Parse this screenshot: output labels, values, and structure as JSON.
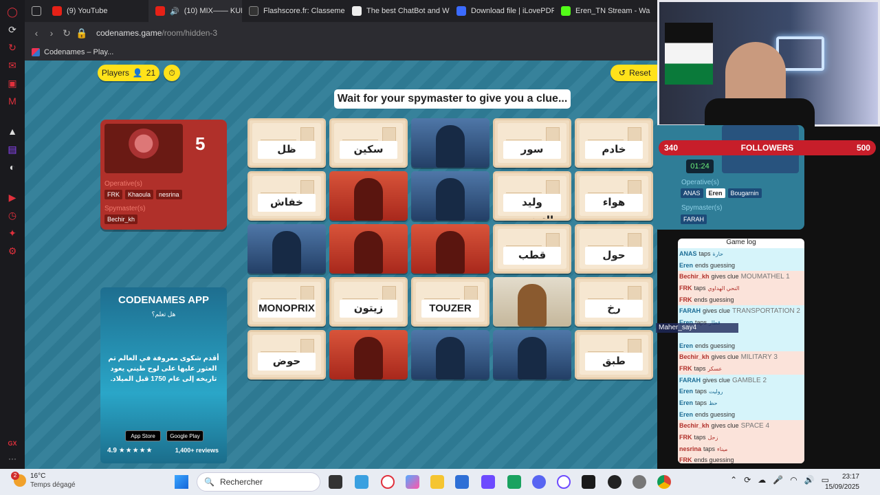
{
  "browser": {
    "tabs": [
      {
        "label": "(9) YouTube",
        "color": "#e62117"
      },
      {
        "label": "(10) MIX—— KUN A",
        "color": "#e62117"
      },
      {
        "label": "Flashscore.fr: Classeme",
        "color": "#333"
      },
      {
        "label": "The best ChatBot and W",
        "color": "#eee"
      },
      {
        "label": "Download file | iLovePDF",
        "color": "#3b6bff"
      },
      {
        "label": "Eren_TN Stream - Wa",
        "color": "#53fc18"
      }
    ],
    "url_host": "codenames.game",
    "url_path": "/room/hidden-3",
    "bookmark": "Codenames – Play..."
  },
  "game": {
    "players_label": "Players",
    "players_count": "21",
    "reset_label": "Reset",
    "banner": "Wait for your spymaster to give you a clue...",
    "red_team": {
      "score": "5",
      "operatives_label": "Operative(s)",
      "operatives": [
        "FRK",
        "Khaoula",
        "nesrina"
      ],
      "spymaster_label": "Spymaster(s)",
      "spymaster": "Bechir_kh"
    },
    "blue_team": {
      "timer": "01:24",
      "operatives_label": "Operative(s)",
      "operatives": [
        "ANAS",
        "Eren",
        "Bougarnin"
      ],
      "spymaster_label": "Spymaster(s)",
      "spymaster": "FARAH"
    },
    "cards": [
      {
        "type": "word",
        "text": "ظل"
      },
      {
        "type": "word",
        "text": "سكين"
      },
      {
        "type": "blue",
        "text": ""
      },
      {
        "type": "word",
        "text": "سور"
      },
      {
        "type": "word",
        "text": "خادم"
      },
      {
        "type": "word",
        "text": "خفاش"
      },
      {
        "type": "red",
        "text": ""
      },
      {
        "type": "blue",
        "text": ""
      },
      {
        "type": "word",
        "text": "وليد التونسي"
      },
      {
        "type": "word",
        "text": "هواء"
      },
      {
        "type": "blue",
        "text": ""
      },
      {
        "type": "red",
        "text": ""
      },
      {
        "type": "red",
        "text": ""
      },
      {
        "type": "word",
        "text": "قطب"
      },
      {
        "type": "word",
        "text": "حول"
      },
      {
        "type": "word",
        "text": "MONOPRIX"
      },
      {
        "type": "word",
        "text": "زيتون"
      },
      {
        "type": "word",
        "text": "TOUZER"
      },
      {
        "type": "neutral",
        "text": ""
      },
      {
        "type": "word",
        "text": "رخ"
      },
      {
        "type": "word",
        "text": "حوض"
      },
      {
        "type": "red",
        "text": ""
      },
      {
        "type": "blue",
        "text": ""
      },
      {
        "type": "blue",
        "text": ""
      },
      {
        "type": "word",
        "text": "طبق"
      }
    ]
  },
  "app_ad": {
    "title": "CODENAMES APP",
    "subtitle": "هل تعلم؟",
    "fact": "أقدم شكوى معروفة في العالم تم العثور عليها على لوح طيني يعود تاريخه إلى عام 1750 قبل الميلاد.",
    "app_store": "App Store",
    "google_play": "Google Play",
    "rating": "4.9",
    "reviews": "1,400+ reviews"
  },
  "stream": {
    "followers_current": "340",
    "followers_label": "FOLLOWERS",
    "followers_goal": "500",
    "chat_user": "Maher_say4"
  },
  "game_log": {
    "title": "Game log",
    "rows": [
      {
        "team": "blue",
        "player": "ANAS",
        "action": "taps",
        "extra": "حارة"
      },
      {
        "team": "blue",
        "player": "Eren",
        "action": "ends guessing",
        "extra": ""
      },
      {
        "team": "red",
        "player": "Bechir_kh",
        "action": "gives clue",
        "extra": "MOUMATHEL 1"
      },
      {
        "team": "red",
        "player": "FRK",
        "action": "taps",
        "extra": "النحي الهداوي"
      },
      {
        "team": "red",
        "player": "FRK",
        "action": "ends guessing",
        "extra": ""
      },
      {
        "team": "blue",
        "player": "FARAH",
        "action": "gives clue",
        "extra": "TRANSPORTATION 2"
      },
      {
        "team": "blue",
        "player": "Eren",
        "action": "taps",
        "extra": "قطار"
      },
      {
        "team": "blue",
        "player": "",
        "action": "",
        "extra": ""
      },
      {
        "team": "blue",
        "player": "Eren",
        "action": "ends guessing",
        "extra": ""
      },
      {
        "team": "red",
        "player": "Bechir_kh",
        "action": "gives clue",
        "extra": "MILITARY 3"
      },
      {
        "team": "red",
        "player": "FRK",
        "action": "taps",
        "extra": "عسكر"
      },
      {
        "team": "blue",
        "player": "FARAH",
        "action": "gives clue",
        "extra": "GAMBLE 2"
      },
      {
        "team": "blue",
        "player": "Eren",
        "action": "taps",
        "extra": "روليت"
      },
      {
        "team": "blue",
        "player": "Eren",
        "action": "taps",
        "extra": "حظ"
      },
      {
        "team": "blue",
        "player": "Eren",
        "action": "ends guessing",
        "extra": ""
      },
      {
        "team": "red",
        "player": "Bechir_kh",
        "action": "gives clue",
        "extra": "SPACE 4"
      },
      {
        "team": "red",
        "player": "FRK",
        "action": "taps",
        "extra": "زحل"
      },
      {
        "team": "red",
        "player": "nesrina",
        "action": "taps",
        "extra": "ميناء"
      },
      {
        "team": "red",
        "player": "FRK",
        "action": "ends guessing",
        "extra": ""
      }
    ]
  },
  "taskbar": {
    "weather_badge": "2",
    "temperature": "16°C",
    "weather_desc": "Temps dégagé",
    "search_placeholder": "Rechercher",
    "time": "23:17",
    "date": "15/09/2025"
  },
  "colors": {
    "red_team": "#b0302a",
    "blue_team": "#1c6d95",
    "accent_yellow": "#ffe21a",
    "board_bg": "#2f7d97"
  }
}
